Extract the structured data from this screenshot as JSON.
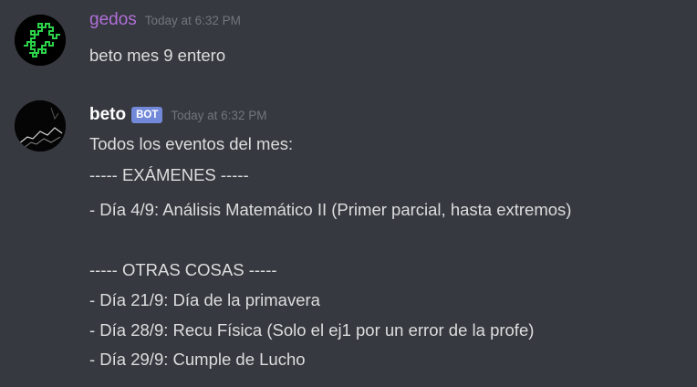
{
  "messages": [
    {
      "username": "gedos",
      "username_color": "#b06fd8",
      "timestamp": "Today at 6:32 PM",
      "avatar_icon": "green-fractal-avatar",
      "lines": [
        "beto mes 9 entero"
      ]
    },
    {
      "username": "beto",
      "username_color": "#ffffff",
      "bot_tag": "BOT",
      "timestamp": "Today at 6:32 PM",
      "avatar_icon": "dark-landscape-avatar",
      "lines": [
        "Todos los eventos del mes:",
        "----- EXÁMENES -----",
        "- Día 4/9: Análisis Matemático II (Primer parcial, hasta extremos)",
        "",
        "----- OTRAS COSAS -----",
        "- Día 21/9: Día de la primavera",
        "- Día 28/9: Recu Física (Solo el ej1 por un error de la profe)",
        "- Día 29/9: Cumple de Lucho"
      ]
    }
  ]
}
